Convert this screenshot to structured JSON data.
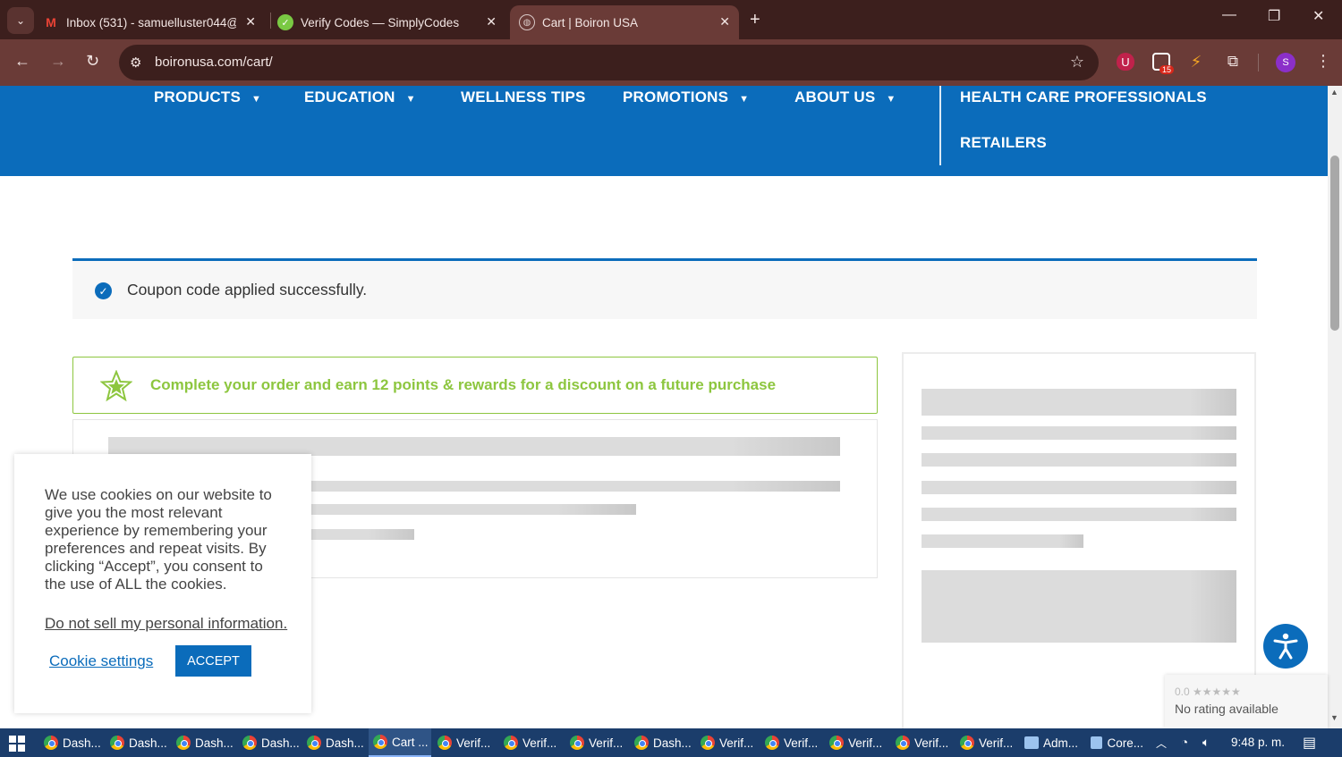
{
  "browser": {
    "tabs": [
      {
        "title": "Inbox (531) - samuelluster044@",
        "icon": "gmail-icon"
      },
      {
        "title": "Verify Codes — SimplyCodes",
        "icon": "simplycodes-icon"
      },
      {
        "title": "Cart | Boiron USA",
        "icon": "globe-icon",
        "active": true
      }
    ],
    "url": "boironusa.com/cart/",
    "extension_badge": "15",
    "profile_initial": "S"
  },
  "site": {
    "nav": {
      "products": "PRODUCTS",
      "education": "EDUCATION",
      "wellness": "WELLNESS TIPS",
      "promotions": "PROMOTIONS",
      "about": "ABOUT US",
      "hcp": "HEALTH CARE PROFESSIONALS",
      "retailers": "RETAILERS"
    },
    "notice": "Coupon code applied successfully.",
    "rewards": "Complete your order and earn 12 points & rewards for a discount on a future purchase",
    "cookie": {
      "text": "We use cookies on our website to give you the most relevant experience by remembering your preferences and repeat visits. By clicking “Accept”, you consent to the use of ALL the cookies.",
      "do_not_sell": "Do not sell my personal information",
      "settings": "Cookie settings",
      "accept": "ACCEPT"
    },
    "rating": {
      "score": "0.0 ★★★★★",
      "text": "No rating available"
    }
  },
  "taskbar": {
    "items": [
      "Dash...",
      "Dash...",
      "Dash...",
      "Dash...",
      "Dash...",
      "Cart ...",
      "Verif...",
      "Verif...",
      "Verif...",
      "Dash...",
      "Verif...",
      "Verif...",
      "Verif...",
      "Verif...",
      "Verif...",
      "Adm...",
      "Core..."
    ],
    "clock": "9:48 p. m."
  },
  "colors": {
    "brand_blue": "#0b6cbb",
    "reward_green": "#8dc63f",
    "chrome_dark": "#3c1f1d"
  }
}
